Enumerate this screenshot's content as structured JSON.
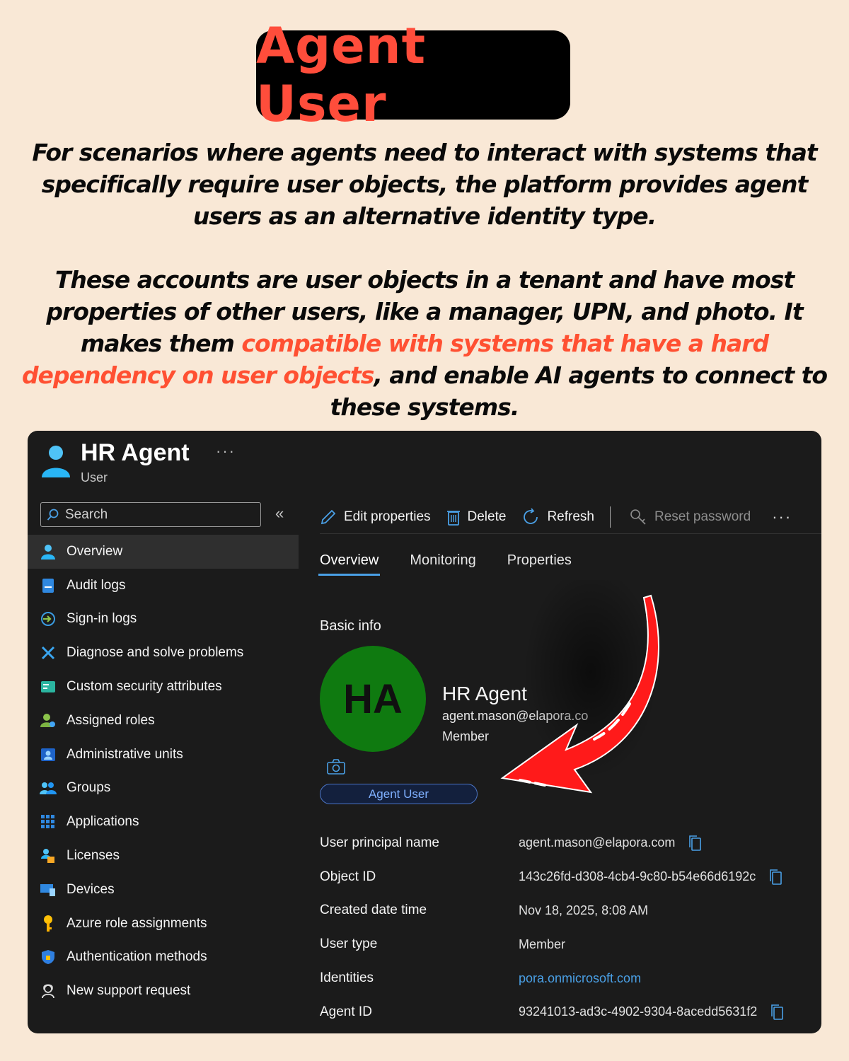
{
  "title": "Agent User",
  "intro": {
    "p1": "For scenarios where agents need to interact with systems that specifically require user objects, the platform provides agent users as an alternative identity type.",
    "p2_before": "These accounts are user objects in a tenant and have most properties of other users, like a manager, UPN, and photo. It makes them ",
    "p2_highlight": "compatible with systems that have a hard dependency on user objects",
    "p2_after": ", and enable AI agents to connect to these systems."
  },
  "panel": {
    "header": {
      "title": "HR Agent",
      "subtitle": "User",
      "more": "···"
    },
    "search": {
      "placeholder": "Search"
    },
    "collapse": "«",
    "nav": [
      {
        "label": "Overview",
        "icon": "user-icon",
        "active": true
      },
      {
        "label": "Audit logs",
        "icon": "log-icon"
      },
      {
        "label": "Sign-in logs",
        "icon": "sign-in-icon"
      },
      {
        "label": "Diagnose and solve problems",
        "icon": "wrench-icon"
      },
      {
        "label": "Custom security attributes",
        "icon": "attributes-icon"
      },
      {
        "label": "Assigned roles",
        "icon": "roles-icon"
      },
      {
        "label": "Administrative units",
        "icon": "admin-units-icon"
      },
      {
        "label": "Groups",
        "icon": "groups-icon"
      },
      {
        "label": "Applications",
        "icon": "apps-grid-icon"
      },
      {
        "label": "Licenses",
        "icon": "license-icon"
      },
      {
        "label": "Devices",
        "icon": "devices-icon"
      },
      {
        "label": "Azure role assignments",
        "icon": "key-icon"
      },
      {
        "label": "Authentication methods",
        "icon": "shield-icon"
      },
      {
        "label": "New support request",
        "icon": "support-icon"
      }
    ],
    "toolbar": {
      "edit": "Edit properties",
      "delete": "Delete",
      "refresh": "Refresh",
      "reset": "Reset password",
      "more": "···"
    },
    "tabs": {
      "overview": "Overview",
      "monitoring": "Monitoring",
      "properties": "Properties"
    },
    "basic_info": "Basic info",
    "profile": {
      "initials": "HA",
      "name": "HR Agent",
      "email": "agent.mason@elapora.co",
      "type": "Member",
      "badge": "Agent User"
    },
    "properties": [
      {
        "key": "User principal name",
        "value": "agent.mason@elapora.com",
        "copy": true
      },
      {
        "key": "Object ID",
        "value": "143c26fd-d308-4cb4-9c80-b54e66d6192c",
        "copy": true
      },
      {
        "key": "Created date time",
        "value": "Nov 18, 2025, 8:08 AM"
      },
      {
        "key": "User type",
        "value": "Member"
      },
      {
        "key": "Identities",
        "value": "pora.onmicrosoft.com",
        "link": true
      },
      {
        "key": "Agent ID",
        "value": "93241013-ad3c-4902-9304-8acedd5631f2",
        "copy": true
      }
    ],
    "colors": {
      "accent": "#4aa0e6",
      "avatar": "#0f7a10",
      "arrow": "#ff1a1a"
    }
  }
}
